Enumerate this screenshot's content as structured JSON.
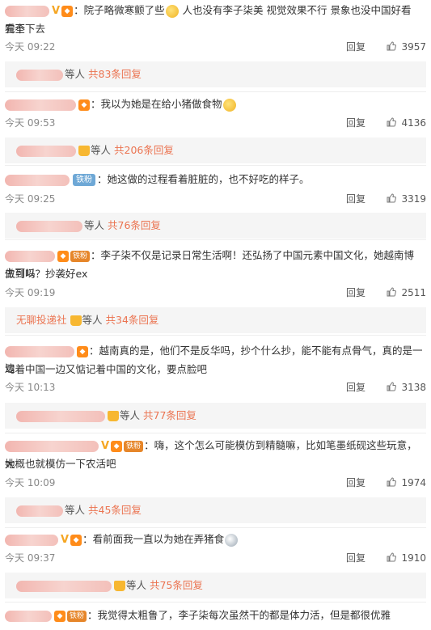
{
  "comments": [
    {
      "text_lines": [
        "：院子略微寒颤了些",
        " 人也没有李子柒美 视觉效果不行 景象也没中国好看 完全",
        "看不下去"
      ],
      "time": "今天 09:22",
      "reply": "回复",
      "likes": "3957",
      "reply_summary": {
        "prefix": "等人",
        "count": "共83条回复"
      }
    },
    {
      "text_lines": [
        "：我以为她是在给小猪做食物"
      ],
      "time": "今天 09:53",
      "reply": "回复",
      "likes": "4136",
      "reply_summary": {
        "prefix": "等人",
        "count": "共206条回复"
      }
    },
    {
      "badge": "铁粉",
      "text_lines": [
        "：她这做的过程看着脏脏的，也不好吃的样子。"
      ],
      "time": "今天 09:25",
      "reply": "回复",
      "likes": "3319",
      "reply_summary": {
        "prefix": "等人",
        "count": "共76条回复"
      }
    },
    {
      "badge": "铁粉",
      "text_lines": [
        "：李子柒不仅是记录日常生活啊！还弘扬了中国元素中国文化，她越南博主可以",
        "做到吗？抄袭好ex"
      ],
      "time": "今天 09:19",
      "reply": "回复",
      "likes": "2511",
      "reply_summary": {
        "name": "无聊投递社",
        "prefix": "等人",
        "count": "共34条回复"
      }
    },
    {
      "text_lines": [
        "：越南真的是，他们不是反华吗，抄个什么抄，能不能有点骨气，真的是一边",
        "骂着中国一边又惦记着中国的文化，要点脸吧"
      ],
      "time": "今天 10:13",
      "reply": "回复",
      "likes": "3138",
      "reply_summary": {
        "prefix": "等人",
        "count": "共77条回复"
      }
    },
    {
      "badge": "铁粉",
      "text_lines": [
        "：嗨，这个怎么可能模仿到精髓嘛，比如笔墨纸砚这些玩意，她",
        "大概也就模仿一下农活吧"
      ],
      "time": "今天 10:09",
      "reply": "回复",
      "likes": "1974",
      "reply_summary": {
        "prefix": "等人",
        "count": "共45条回复"
      }
    },
    {
      "text_lines": [
        "：看前面我一直以为她在弄猪食"
      ],
      "time": "今天 09:37",
      "reply": "回复",
      "likes": "1910",
      "reply_summary": {
        "prefix": "等人",
        "count": "共75条回复"
      }
    },
    {
      "badge": "铁粉",
      "text_lines": [
        "：我觉得太粗鲁了，李子柒每次虽然干的都是体力活，但是都很优雅"
      ]
    }
  ],
  "colors": {
    "accent": "#eb7350",
    "reply_bg": "#f5f5f5",
    "meta": "#888888"
  },
  "icons": [
    "thumbs-up-icon",
    "verified-v-icon",
    "member-crown-icon",
    "emoji-icon"
  ]
}
